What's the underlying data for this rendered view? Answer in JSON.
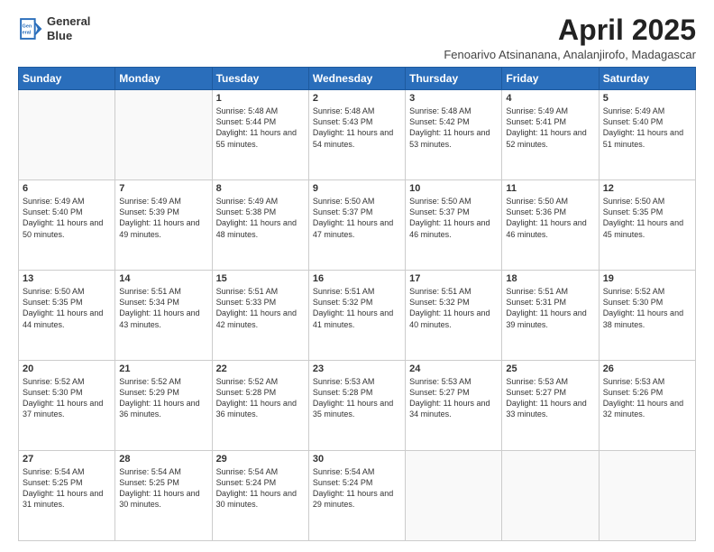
{
  "header": {
    "logo_line1": "General",
    "logo_line2": "Blue",
    "month": "April 2025",
    "location": "Fenoarivo Atsinanana, Analanjirofo, Madagascar"
  },
  "days_of_week": [
    "Sunday",
    "Monday",
    "Tuesday",
    "Wednesday",
    "Thursday",
    "Friday",
    "Saturday"
  ],
  "weeks": [
    [
      {
        "day": "",
        "info": ""
      },
      {
        "day": "",
        "info": ""
      },
      {
        "day": "1",
        "info": "Sunrise: 5:48 AM\nSunset: 5:44 PM\nDaylight: 11 hours and 55 minutes."
      },
      {
        "day": "2",
        "info": "Sunrise: 5:48 AM\nSunset: 5:43 PM\nDaylight: 11 hours and 54 minutes."
      },
      {
        "day": "3",
        "info": "Sunrise: 5:48 AM\nSunset: 5:42 PM\nDaylight: 11 hours and 53 minutes."
      },
      {
        "day": "4",
        "info": "Sunrise: 5:49 AM\nSunset: 5:41 PM\nDaylight: 11 hours and 52 minutes."
      },
      {
        "day": "5",
        "info": "Sunrise: 5:49 AM\nSunset: 5:40 PM\nDaylight: 11 hours and 51 minutes."
      }
    ],
    [
      {
        "day": "6",
        "info": "Sunrise: 5:49 AM\nSunset: 5:40 PM\nDaylight: 11 hours and 50 minutes."
      },
      {
        "day": "7",
        "info": "Sunrise: 5:49 AM\nSunset: 5:39 PM\nDaylight: 11 hours and 49 minutes."
      },
      {
        "day": "8",
        "info": "Sunrise: 5:49 AM\nSunset: 5:38 PM\nDaylight: 11 hours and 48 minutes."
      },
      {
        "day": "9",
        "info": "Sunrise: 5:50 AM\nSunset: 5:37 PM\nDaylight: 11 hours and 47 minutes."
      },
      {
        "day": "10",
        "info": "Sunrise: 5:50 AM\nSunset: 5:37 PM\nDaylight: 11 hours and 46 minutes."
      },
      {
        "day": "11",
        "info": "Sunrise: 5:50 AM\nSunset: 5:36 PM\nDaylight: 11 hours and 46 minutes."
      },
      {
        "day": "12",
        "info": "Sunrise: 5:50 AM\nSunset: 5:35 PM\nDaylight: 11 hours and 45 minutes."
      }
    ],
    [
      {
        "day": "13",
        "info": "Sunrise: 5:50 AM\nSunset: 5:35 PM\nDaylight: 11 hours and 44 minutes."
      },
      {
        "day": "14",
        "info": "Sunrise: 5:51 AM\nSunset: 5:34 PM\nDaylight: 11 hours and 43 minutes."
      },
      {
        "day": "15",
        "info": "Sunrise: 5:51 AM\nSunset: 5:33 PM\nDaylight: 11 hours and 42 minutes."
      },
      {
        "day": "16",
        "info": "Sunrise: 5:51 AM\nSunset: 5:32 PM\nDaylight: 11 hours and 41 minutes."
      },
      {
        "day": "17",
        "info": "Sunrise: 5:51 AM\nSunset: 5:32 PM\nDaylight: 11 hours and 40 minutes."
      },
      {
        "day": "18",
        "info": "Sunrise: 5:51 AM\nSunset: 5:31 PM\nDaylight: 11 hours and 39 minutes."
      },
      {
        "day": "19",
        "info": "Sunrise: 5:52 AM\nSunset: 5:30 PM\nDaylight: 11 hours and 38 minutes."
      }
    ],
    [
      {
        "day": "20",
        "info": "Sunrise: 5:52 AM\nSunset: 5:30 PM\nDaylight: 11 hours and 37 minutes."
      },
      {
        "day": "21",
        "info": "Sunrise: 5:52 AM\nSunset: 5:29 PM\nDaylight: 11 hours and 36 minutes."
      },
      {
        "day": "22",
        "info": "Sunrise: 5:52 AM\nSunset: 5:28 PM\nDaylight: 11 hours and 36 minutes."
      },
      {
        "day": "23",
        "info": "Sunrise: 5:53 AM\nSunset: 5:28 PM\nDaylight: 11 hours and 35 minutes."
      },
      {
        "day": "24",
        "info": "Sunrise: 5:53 AM\nSunset: 5:27 PM\nDaylight: 11 hours and 34 minutes."
      },
      {
        "day": "25",
        "info": "Sunrise: 5:53 AM\nSunset: 5:27 PM\nDaylight: 11 hours and 33 minutes."
      },
      {
        "day": "26",
        "info": "Sunrise: 5:53 AM\nSunset: 5:26 PM\nDaylight: 11 hours and 32 minutes."
      }
    ],
    [
      {
        "day": "27",
        "info": "Sunrise: 5:54 AM\nSunset: 5:25 PM\nDaylight: 11 hours and 31 minutes."
      },
      {
        "day": "28",
        "info": "Sunrise: 5:54 AM\nSunset: 5:25 PM\nDaylight: 11 hours and 30 minutes."
      },
      {
        "day": "29",
        "info": "Sunrise: 5:54 AM\nSunset: 5:24 PM\nDaylight: 11 hours and 30 minutes."
      },
      {
        "day": "30",
        "info": "Sunrise: 5:54 AM\nSunset: 5:24 PM\nDaylight: 11 hours and 29 minutes."
      },
      {
        "day": "",
        "info": ""
      },
      {
        "day": "",
        "info": ""
      },
      {
        "day": "",
        "info": ""
      }
    ]
  ]
}
